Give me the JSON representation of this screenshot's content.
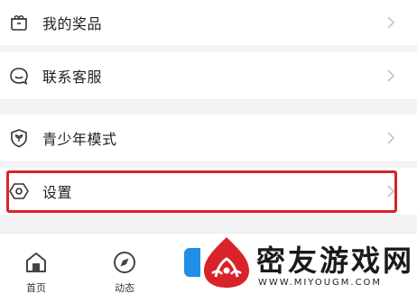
{
  "menu": {
    "items": [
      {
        "label": "我的奖品",
        "icon": "gift-box-icon"
      },
      {
        "label": "联系客服",
        "icon": "customer-service-icon"
      },
      {
        "label": "青少年模式",
        "icon": "youth-shield-icon"
      },
      {
        "label": "设置",
        "icon": "settings-hexagon-icon"
      }
    ]
  },
  "highlight_color": "#d8232a",
  "tabbar": {
    "tabs": [
      {
        "label": "首页",
        "icon": "home-icon"
      },
      {
        "label": "动态",
        "icon": "compass-icon"
      }
    ]
  },
  "watermark": {
    "title": "密友游戏网",
    "url": "WWW.MIYOUGM.COM",
    "logo_color": "#d8232a"
  }
}
